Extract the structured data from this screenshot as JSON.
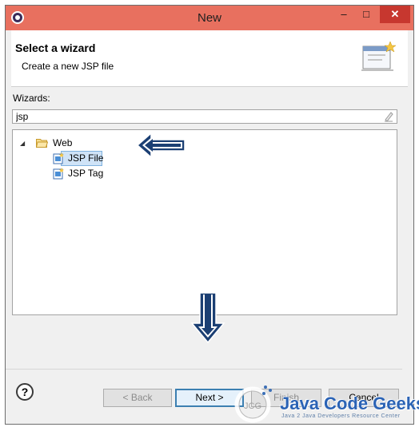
{
  "window": {
    "title": "New"
  },
  "header": {
    "title": "Select a wizard",
    "description": "Create a new JSP file"
  },
  "content": {
    "label": "Wizards:",
    "filter_value": "jsp",
    "tree": {
      "folder": "Web",
      "items": [
        {
          "label": "JSP File",
          "selected": true
        },
        {
          "label": "JSP Tag",
          "selected": false
        }
      ]
    }
  },
  "buttons": {
    "help": "?",
    "back": "< Back",
    "next": "Next >",
    "finish": "Finish",
    "cancel": "Cancel"
  },
  "watermark": {
    "line1": "Java Code Geeks",
    "line2": "Java 2 Java Developers Resource Center"
  },
  "colors": {
    "titlebar": "#e8705f",
    "close": "#c7372f",
    "selection": "#cfe3f7",
    "arrow": "#1b3f73"
  }
}
